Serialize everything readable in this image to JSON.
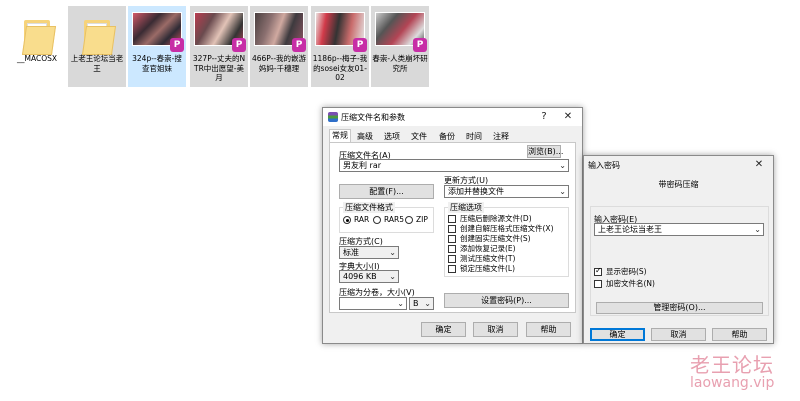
{
  "desktop": {
    "files": [
      {
        "name": "__MACOSX",
        "kind": "folder"
      },
      {
        "name": "上老王论坛当老王",
        "kind": "folder"
      },
      {
        "name": "324p--春崇-搜查官姐妹",
        "kind": "archive"
      },
      {
        "name": "327P--丈夫的NTR中出愿望-美月",
        "kind": "archive"
      },
      {
        "name": "466P--我的嵌游妈妈-千穗理",
        "kind": "archive"
      },
      {
        "name": "1186p--梅子-我的sosei女友01-02",
        "kind": "archive"
      },
      {
        "name": "春崇-人类崩坏研究所",
        "kind": "archive"
      }
    ],
    "app_badge": "P"
  },
  "archive_dialog": {
    "title": "压缩文件名和参数",
    "help_glyph": "?",
    "close_glyph": "✕",
    "tabs": [
      "常规",
      "高级",
      "选项",
      "文件",
      "备份",
      "时间",
      "注释"
    ],
    "active_tab": "常规",
    "archive_name_label": "压缩文件名(A)",
    "archive_name_value": "男友利 rar",
    "browse_button": "浏览(B)...",
    "profiles_button": "配置(F)...",
    "update_mode_label": "更新方式(U)",
    "update_mode_value": "添加并替换文件",
    "format_group": "压缩文件格式",
    "formats": [
      {
        "label": "RAR",
        "checked": true
      },
      {
        "label": "RAR5",
        "checked": false
      },
      {
        "label": "ZIP",
        "checked": false
      }
    ],
    "method_label": "压缩方式(C)",
    "method_value": "标准",
    "dict_label": "字典大小(I)",
    "dict_value": "4096 KB",
    "split_label": "压缩为分卷，大小(V)",
    "split_value": "",
    "split_unit": "B",
    "options_group": "压缩选项",
    "options": [
      {
        "label": "压缩后删除源文件(D)",
        "checked": false
      },
      {
        "label": "创建自解压格式压缩文件(X)",
        "checked": false
      },
      {
        "label": "创建固实压缩文件(S)",
        "checked": false
      },
      {
        "label": "添加恢复记录(E)",
        "checked": false
      },
      {
        "label": "测试压缩文件(T)",
        "checked": false
      },
      {
        "label": "锁定压缩文件(L)",
        "checked": false
      }
    ],
    "set_password_button": "设置密码(P)...",
    "ok_button": "确定",
    "cancel_button": "取消",
    "help_button": "帮助"
  },
  "password_dialog": {
    "title": "输入密码",
    "close_glyph": "✕",
    "heading": "带密码压缩",
    "password_label": "输入密码(E)",
    "password_value": "上老王论坛当老王",
    "show_password": {
      "label": "显示密码(S)",
      "checked": true
    },
    "encrypt_names": {
      "label": "加密文件名(N)",
      "checked": false
    },
    "organize_button": "管理密码(O)...",
    "ok_button": "确定",
    "cancel_button": "取消",
    "help_button": "帮助"
  },
  "watermark": {
    "title": "老王论坛",
    "url": "laowang.vip"
  },
  "colors": {
    "selection": "#cce8ff",
    "accent": "#0078d7",
    "watermark": "#e8a0b0"
  }
}
